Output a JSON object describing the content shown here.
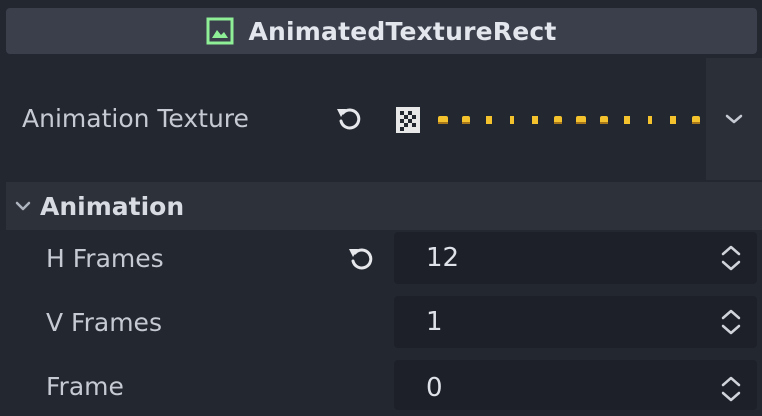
{
  "inspector": {
    "node_title": "AnimatedTextureRect",
    "node_icon": "texture-rect-icon",
    "texture_row": {
      "label": "Animation Texture",
      "revert_icon": "revert-icon",
      "preview_icon": "checker-texture-icon",
      "dropdown_icon": "chevron-down-icon"
    },
    "section": {
      "label": "Animation",
      "icon": "chevron-down-icon"
    },
    "properties": [
      {
        "label": "H Frames",
        "value": "12",
        "has_revert": true
      },
      {
        "label": "V Frames",
        "value": "1",
        "has_revert": false
      },
      {
        "label": "Frame",
        "value": "0",
        "has_revert": false
      }
    ]
  },
  "colors": {
    "background": "#232730",
    "header": "#3a3f4b",
    "section": "#2c313a",
    "field": "#1d2028",
    "icon_green": "#8eef97",
    "frame_yellow": "#f3c22c"
  }
}
